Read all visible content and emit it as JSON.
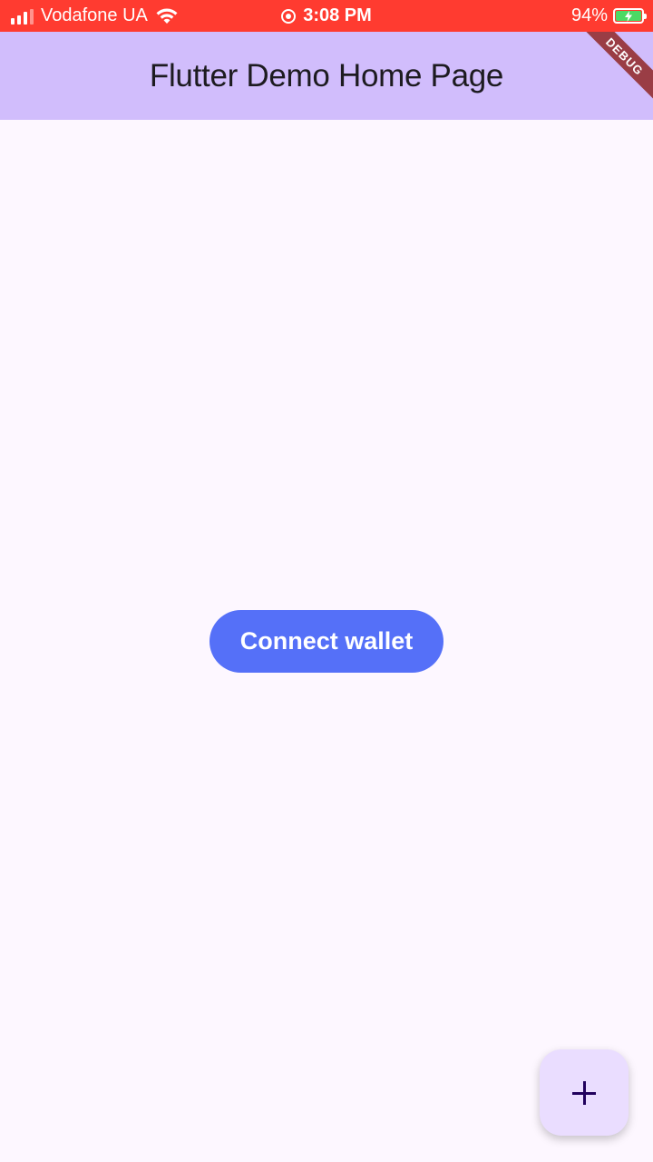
{
  "status_bar": {
    "carrier": "Vodafone UA",
    "time": "3:08 PM",
    "battery_percent": "94%",
    "battery_level": 0.94,
    "icons": [
      "signal-icon",
      "wifi-icon",
      "screen-record-icon",
      "battery-charging-icon"
    ]
  },
  "app_bar": {
    "title": "Flutter Demo Home Page",
    "background_color": "#d1bdfc"
  },
  "debug_banner": {
    "label": "DEBUG",
    "visible_text": "BUG",
    "color": "#9a3d45"
  },
  "main": {
    "connect_button_label": "Connect wallet",
    "connect_button_color": "#5570f8"
  },
  "fab": {
    "icon": "plus-icon",
    "background_color": "#eaddff"
  },
  "theme": {
    "page_background": "#fdf7ff",
    "status_bar_color": "#ff3b30"
  }
}
